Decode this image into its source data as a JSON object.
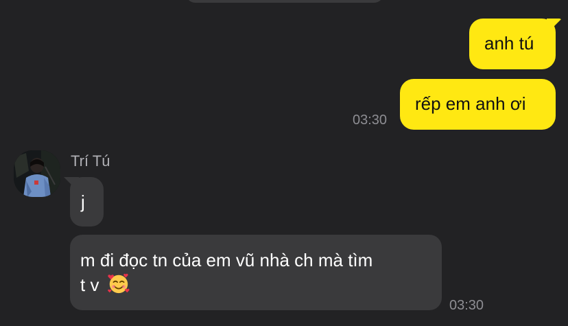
{
  "messages": {
    "outgoing": [
      {
        "text": "anh tú"
      },
      {
        "text": "rếp em anh ơi",
        "time": "03:30"
      }
    ],
    "incoming": {
      "sender": "Trí Tú",
      "items": [
        {
          "text": "j"
        },
        {
          "line1": "m đi đọc tn của em vũ nhà ch mà tìm",
          "line2": "t v",
          "emoji": "smiling-face-with-hearts",
          "time": "03:30"
        }
      ]
    }
  },
  "colors": {
    "background": "#222224",
    "outgoing_bubble": "#ffe812",
    "incoming_bubble": "#3a3a3c"
  }
}
